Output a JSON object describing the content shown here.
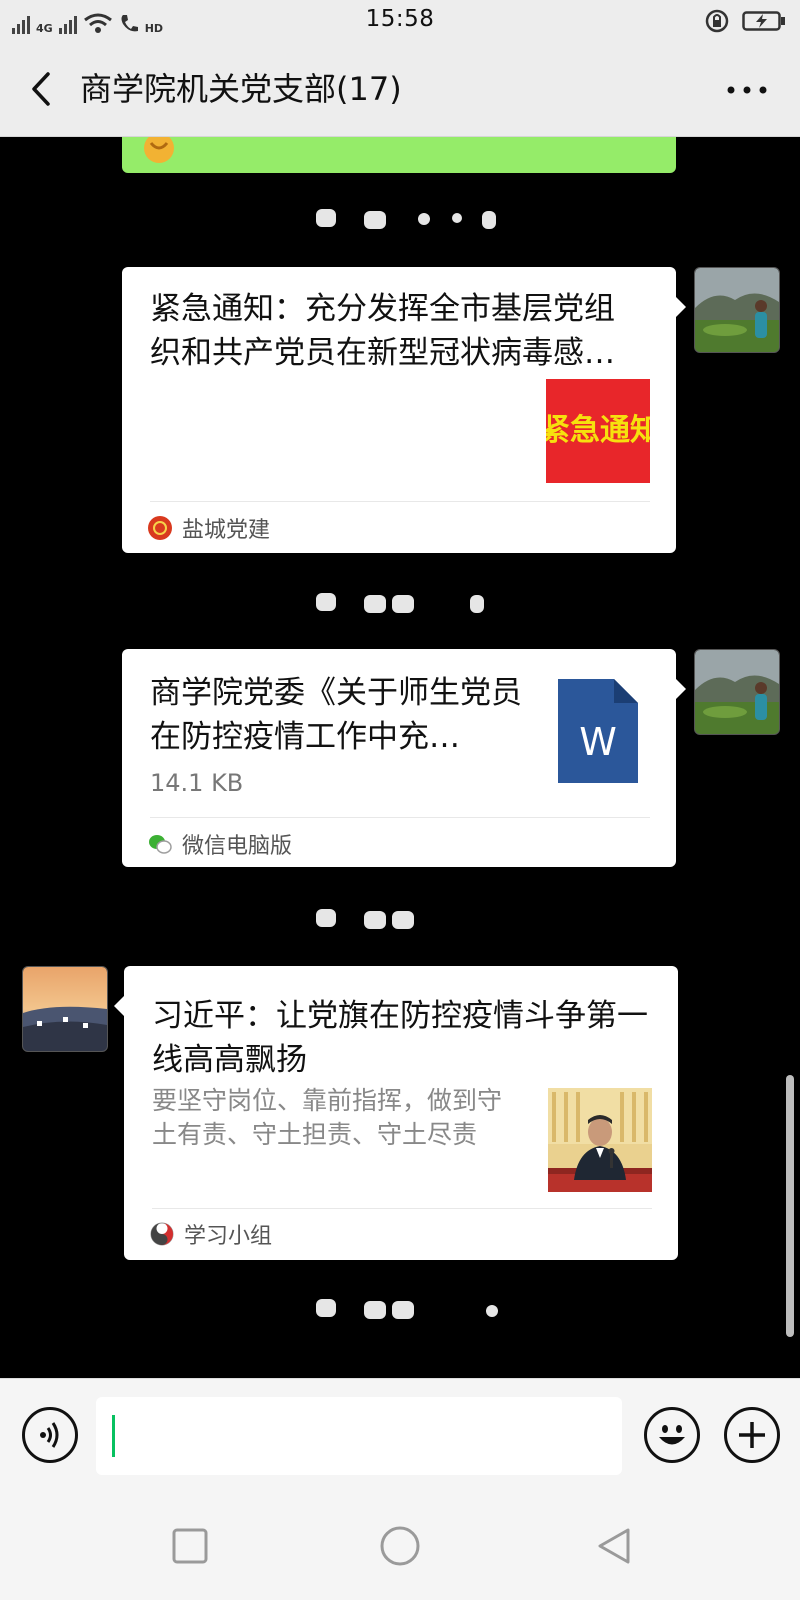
{
  "status_bar": {
    "network": "4G",
    "hd": "HD",
    "time": "15:58"
  },
  "header": {
    "title": "商学院机关党支部(17)",
    "back_icon": "chevron-left-icon",
    "more_icon": "more-dots-icon"
  },
  "messages": [
    {
      "type": "article",
      "direction": "outgoing",
      "title": "紧急通知：充分发挥全市基层党组织和共产党员在新型冠状病毒感…",
      "thumb_text": "紧急通知",
      "source": "盐城党建"
    },
    {
      "type": "file",
      "direction": "outgoing",
      "title": "商学院党委《关于师生党员在防控疫情工作中充…",
      "size": "14.1 KB",
      "file_icon_letter": "W",
      "source": "微信电脑版"
    },
    {
      "type": "article",
      "direction": "incoming",
      "title": "习近平：让党旗在防控疫情斗争第一线高高飘扬",
      "summary": "要坚守岗位、靠前指挥，做到守土有责、守土担责、守土尽责",
      "source": "学习小组"
    }
  ],
  "input_bar": {
    "value": "",
    "placeholder": ""
  },
  "colors": {
    "chat_background": "#000000",
    "outgoing_bubble": "#95ec69",
    "caret": "#07c160",
    "word_icon": "#2b579a"
  }
}
